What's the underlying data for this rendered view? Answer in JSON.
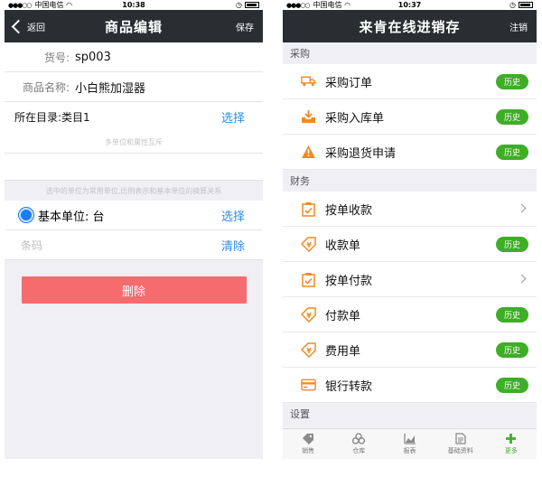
{
  "left": {
    "status": {
      "carrier": "中国电信",
      "time": "10:38"
    },
    "nav": {
      "back_label": "返回",
      "title": "商品编辑",
      "save_label": "保存"
    },
    "form": {
      "sku_label": "货号:",
      "sku_value": "sp003",
      "name_label": "商品名称:",
      "name_value": "小白熊加湿器",
      "dir_label": "所在目录:",
      "dir_value": "类目1",
      "dir_select": "选择",
      "multi_unit_hint": "多单位和属性互斥",
      "unit_hint": "选中的单位为常用单位,比例表示和基本单位的换算关系",
      "base_unit_label": "基本单位:",
      "base_unit_value": "台",
      "unit_select": "选择",
      "barcode_placeholder": "条码",
      "barcode_clear": "清除",
      "delete_label": "删除"
    }
  },
  "right": {
    "status": {
      "carrier": "中国电信",
      "time": "10:37"
    },
    "nav": {
      "title": "来肯在线进销存",
      "logout_label": "注销"
    },
    "sections": [
      {
        "title": "采购",
        "items": [
          {
            "label": "采购订单",
            "icon": "truck-icon",
            "action": "历史"
          },
          {
            "label": "采购入库单",
            "icon": "inbox-download-icon",
            "action": "历史"
          },
          {
            "label": "采购退货申请",
            "icon": "warning-icon",
            "action": "历史"
          }
        ]
      },
      {
        "title": "财务",
        "items": [
          {
            "label": "按单收款",
            "icon": "clipboard-check-icon",
            "action": ""
          },
          {
            "label": "收款单",
            "icon": "money-tag-icon",
            "action": "历史"
          },
          {
            "label": "按单付款",
            "icon": "clipboard-check-icon",
            "action": ""
          },
          {
            "label": "付款单",
            "icon": "money-tag-icon",
            "action": "历史"
          },
          {
            "label": "费用单",
            "icon": "money-tag-icon",
            "action": "历史"
          },
          {
            "label": "银行转款",
            "icon": "bank-card-icon",
            "action": "历史"
          }
        ]
      },
      {
        "title": "设置",
        "items": []
      }
    ],
    "tabs": [
      {
        "label": "销售",
        "icon": "tag-icon",
        "active": false
      },
      {
        "label": "仓库",
        "icon": "boxes-icon",
        "active": false
      },
      {
        "label": "报表",
        "icon": "chart-icon",
        "active": false
      },
      {
        "label": "基础资料",
        "icon": "document-icon",
        "active": false
      },
      {
        "label": "更多",
        "icon": "plus-icon",
        "active": true
      }
    ]
  },
  "colors": {
    "nav_bg": "#2a2e33",
    "accent_orange": "#f08a24",
    "history_green": "#3fae27",
    "link_blue": "#2b8de8",
    "delete_red": "#f56b6e"
  }
}
